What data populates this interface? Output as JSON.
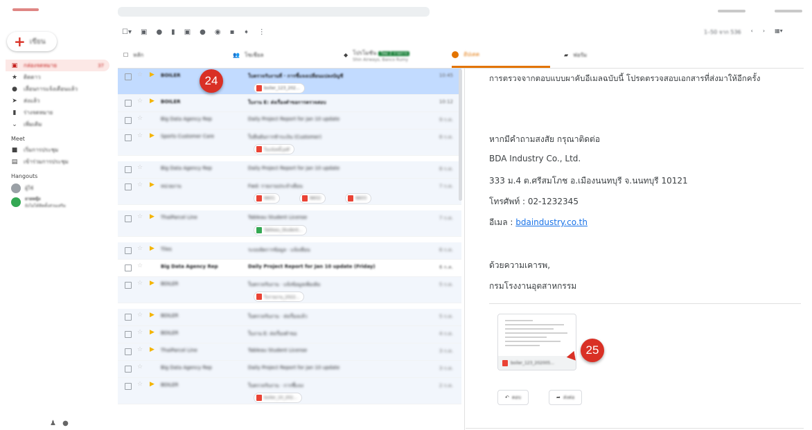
{
  "compose": {
    "label": "เขียน"
  },
  "sidebar": {
    "items": [
      {
        "label": "กล่องจดหมาย",
        "count": "37",
        "icon": "inbox-icon"
      },
      {
        "label": "ติดดาว",
        "icon": "star-icon"
      },
      {
        "label": "เลื่อนการแจ้งเตือนแล้ว",
        "icon": "clock-icon"
      },
      {
        "label": "ส่งแล้ว",
        "icon": "send-icon"
      },
      {
        "label": "ร่างจดหมาย",
        "icon": "draft-icon"
      },
      {
        "label": "เพิ่มเติม",
        "icon": "chevron-down-icon"
      }
    ],
    "meet_title": "Meet",
    "meet_items": [
      {
        "label": "เริ่มการประชุม",
        "icon": "video-icon"
      },
      {
        "label": "เข้าร่วมการประชุม",
        "icon": "keyboard-icon"
      }
    ],
    "hangouts_title": "Hangouts",
    "hangouts_user": "ผู้ใช้",
    "hangouts_contact": {
      "name": "ยายหญิง",
      "status": "ยังไม่ได้ติดตั้งส่วนเสริม"
    }
  },
  "toolbar": {
    "icons": [
      "select-checkbox-icon",
      "archive-icon",
      "report-spam-icon",
      "delete-icon",
      "mark-unread-icon",
      "snooze-icon",
      "add-task-icon",
      "move-to-icon",
      "label-icon",
      "more-icon"
    ],
    "pager": "1–50 จาก 536"
  },
  "tabs": [
    {
      "label": "หลัก",
      "icon": "inbox-icon"
    },
    {
      "label": "โซเชียล",
      "icon": "people-icon"
    },
    {
      "label": "โปรโมชัน",
      "badge": "ใหม่ 2 รายการ",
      "sub": "Shin Airways, Banco Rumy",
      "icon": "tag-icon"
    },
    {
      "label": "อัปเดต",
      "icon": "info-icon"
    },
    {
      "label": "ฟอรัม",
      "icon": "forum-icon"
    }
  ],
  "emails": [
    {
      "sender": "BOILER",
      "subject": "ใบตรวจรับงานที่ · การชี้แจงเปลี่ยนแปลงบัญชี",
      "date": "10:45",
      "attachment": "boiler_123_202...",
      "state": "selected"
    },
    {
      "sender": "BOILER",
      "subject": "ใบงาน E: ส่งเรื่องคำขอการตรวจสอบ",
      "date": "10:12",
      "state": "unread"
    },
    {
      "sender": "Big Data Agency Rep",
      "subject": "Daily Project Report for Jan 10 update",
      "date": "9 ก.ค.",
      "state": "read"
    },
    {
      "sender": "Sports Customer Care",
      "subject": "ใบยืนยันการชำระเงิน (Customer)",
      "date": "8 ก.ค.",
      "attachment": "ใบแจ้งหนี้.pdf",
      "state": "read"
    },
    {
      "sender": "Big Data Agency Rep",
      "subject": "Daily Project Report for Jan 10 update",
      "date": "8 ก.ค.",
      "state": "read"
    },
    {
      "sender": "หน่วยงาน",
      "subject": "Fwd: รายงานประจำเดือน",
      "date": "7 ก.ค.",
      "attachments": [
        "NK01",
        "NK02",
        "NK03"
      ],
      "state": "read"
    },
    {
      "sender": "ThaiParcel Line",
      "subject": "Tableau Student License",
      "date": "7 ก.ค.",
      "attachment": "Tableau_Student...",
      "attachment_type": "sheet",
      "state": "read"
    },
    {
      "sender": "Tiles",
      "subject": "ระบบจัดการข้อมูล · แจ้งเตือน",
      "date": "6 ก.ค.",
      "state": "read"
    },
    {
      "sender": "Big Data Agency Rep",
      "subject": "Daily Project Report for Jan 10 update (Friday)",
      "date": "6 ก.ค.",
      "state": "unread"
    },
    {
      "sender": "BOILER",
      "subject": "ใบตรวจรับงาน · แจ้งข้อมูลเพิ่มเติม",
      "date": "5 ก.ค.",
      "attachment": "ใบรายงาน_2022...",
      "state": "read"
    },
    {
      "sender": "BOILER",
      "subject": "ใบตรวจรับงาน · ส่งเรื่องแล้ว",
      "date": "5 ก.ค.",
      "state": "read"
    },
    {
      "sender": "BOILER",
      "subject": "ใบงาน E: ส่งเรื่องคำขอ",
      "date": "4 ก.ค.",
      "state": "read"
    },
    {
      "sender": "ThaiParcel Line",
      "subject": "Tableau Student License",
      "date": "3 ก.ค.",
      "state": "read"
    },
    {
      "sender": "Big Data Agency Rep",
      "subject": "Daily Project Report for Jan 10 update",
      "date": "3 ก.ค.",
      "state": "read"
    },
    {
      "sender": "BOILER",
      "subject": "ใบตรวจรับงาน · การชี้แจง",
      "date": "2 ก.ค.",
      "attachment": "boiler_10_202...",
      "state": "read"
    }
  ],
  "message": {
    "top_text": "การตรวจจากตอบแบบผาคับอีเมลฉบับนี้ โปรดตรวจสอบเอกสารที่ส่งมาให้อีกครั้ง",
    "contact_heading": "หากมีคำถามสงสัย กรุณาติดต่อ",
    "company": "BDA Industry Co., Ltd.",
    "address": "333 ม.4 ต.ศรีสมโภช อ.เมืองนนทบุรี จ.นนทบุรี 10121",
    "phone": "โทรศัพท์ : 02-1232345",
    "website_label": "อีเมล : ",
    "website": "bdaindustry.co.th",
    "closing": "ด้วยความเคารพ,",
    "signature": "กรมโรงงานอุตสาหกรรม",
    "attachment_name": "boiler_123_202005...",
    "reply_label": "ตอบ",
    "forward_label": "ส่งต่อ"
  },
  "callouts": [
    "24",
    "25"
  ],
  "colors": {
    "accent": "#d93025",
    "active_tab": "#e37400",
    "selected_row": "#c2dbff",
    "link": "#1a73e8"
  }
}
